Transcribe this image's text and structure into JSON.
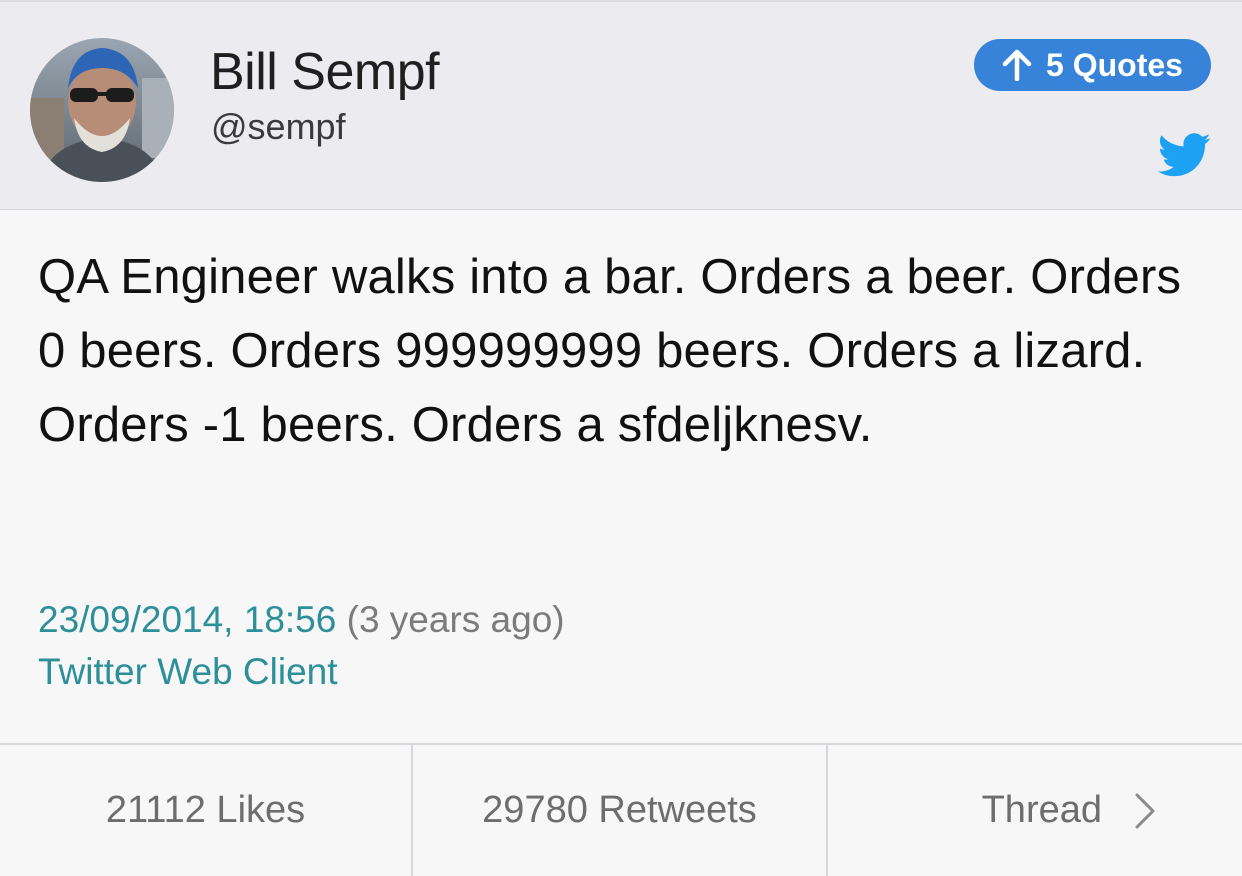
{
  "header": {
    "user_name": "Bill Sempf",
    "user_handle": "@sempf",
    "quotes_label": "5 Quotes",
    "quotes_icon": "up-arrow-icon",
    "service_icon": "twitter-bird-icon",
    "accent_color": "#3783d9"
  },
  "tweet": {
    "text": "QA Engineer walks into a bar. Orders a beer. Orders 0 beers. Orders 999999999 beers. Orders a lizard. Orders -1 beers. Orders a sfdeljknesv.",
    "timestamp": "23/09/2014, 18:56",
    "relative_time": "(3 years ago)",
    "source": "Twitter Web Client",
    "link_color": "#2c8f9a"
  },
  "footer": {
    "likes_label": "21112 Likes",
    "retweets_label": "29780 Retweets",
    "thread_label": "Thread",
    "thread_icon": "chevron-right-icon"
  }
}
